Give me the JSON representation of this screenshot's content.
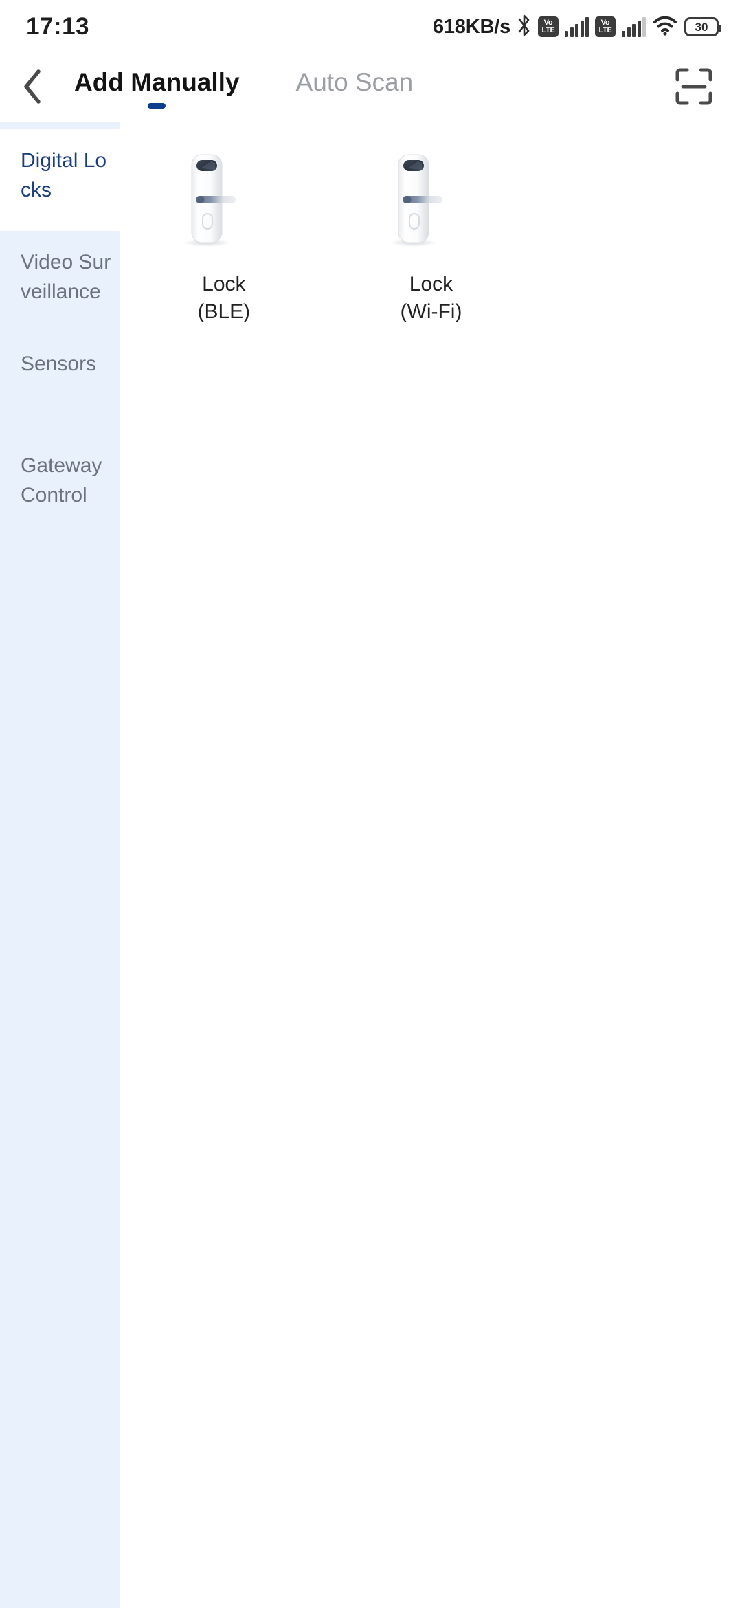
{
  "status_bar": {
    "time": "17:13",
    "network_speed": "618KB/s",
    "bluetooth_icon": "bluetooth-icon",
    "sim1": {
      "volte_top": "Vo",
      "volte_bottom": "LTE",
      "signal_icon": "signal-bars-icon"
    },
    "sim2": {
      "volte_top": "Vo",
      "volte_bottom": "LTE",
      "signal_icon": "signal-bars-icon"
    },
    "wifi_icon": "wifi-icon",
    "battery_level": "30"
  },
  "header": {
    "back_icon": "chevron-left-icon",
    "scan_icon": "scan-frame-icon",
    "tabs": [
      {
        "label": "Add Manually",
        "active": true
      },
      {
        "label": "Auto Scan",
        "active": false
      }
    ]
  },
  "sidebar": {
    "items": [
      {
        "label": "Digital Locks",
        "active": true
      },
      {
        "label": "Video Surveillance",
        "active": false
      },
      {
        "label": "Sensors",
        "active": false
      },
      {
        "label": "Gateway Control",
        "active": false
      }
    ]
  },
  "main": {
    "products": [
      {
        "name": "Lock\n(BLE)",
        "image": "smart-door-lock-image"
      },
      {
        "name": "Lock\n(Wi-Fi)",
        "image": "smart-door-lock-image"
      }
    ]
  },
  "colors": {
    "accent_blue": "#0d3d8e",
    "sidebar_bg": "#e8f1fc",
    "active_item_text": "#193f7f",
    "inactive_text": "#6d737c",
    "tab_inactive": "#9b9ea3"
  }
}
